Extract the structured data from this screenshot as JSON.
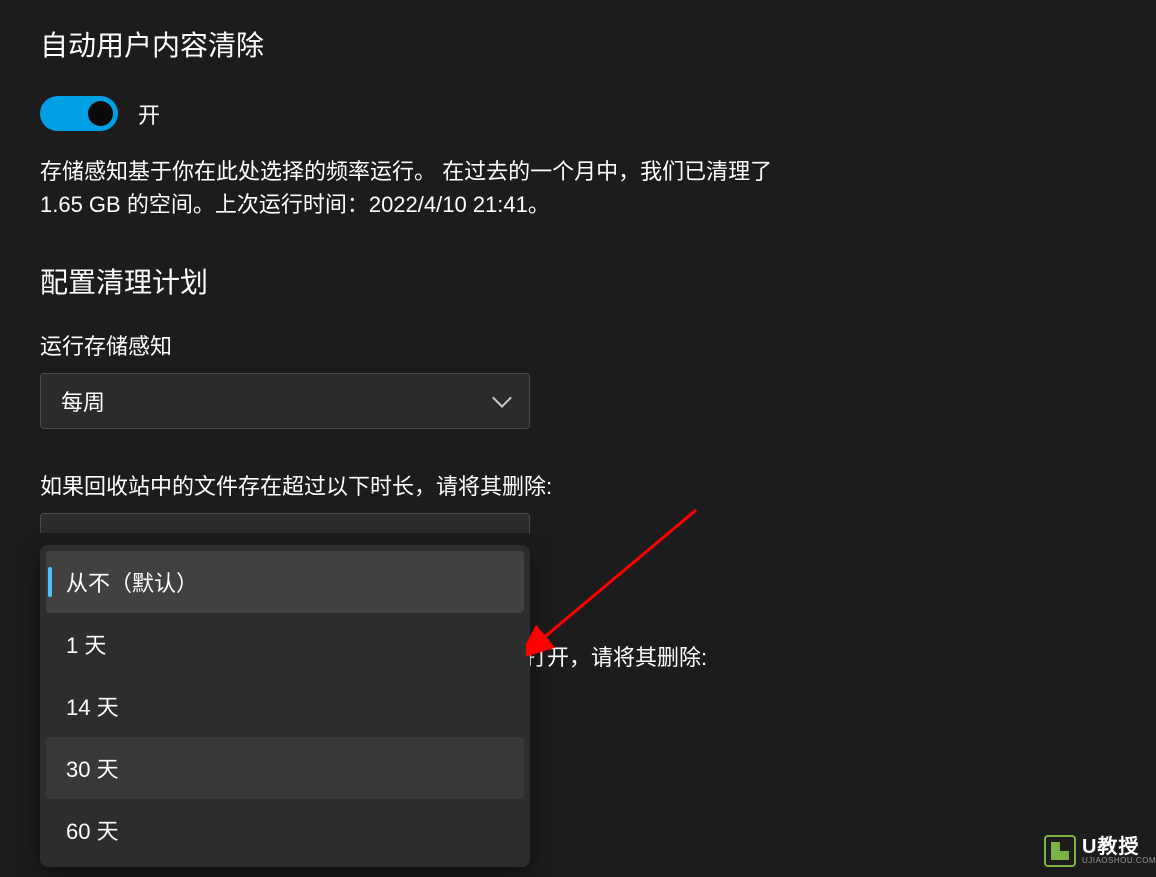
{
  "page": {
    "title": "自动用户内容清除"
  },
  "toggle": {
    "state": "on",
    "label": "开"
  },
  "description": "存储感知基于你在此处选择的频率运行。 在过去的一个月中，我们已清理了 1.65 GB 的空间。上次运行时间：2022/4/10 21:41。",
  "subsection": {
    "title": "配置清理计划"
  },
  "frequency": {
    "label": "运行存储感知",
    "selected": "每周"
  },
  "recycle_bin": {
    "label": "如果回收站中的文件存在超过以下时长，请将其删除:",
    "options": [
      "从不（默认）",
      "1 天",
      "14 天",
      "30 天",
      "60 天"
    ],
    "selected_index": 0,
    "hovered_index": 3
  },
  "obscured_text": "打开，请将其删除:",
  "watermark": {
    "title": "U教授",
    "subtitle": "UJIAOSHOU.COM"
  }
}
